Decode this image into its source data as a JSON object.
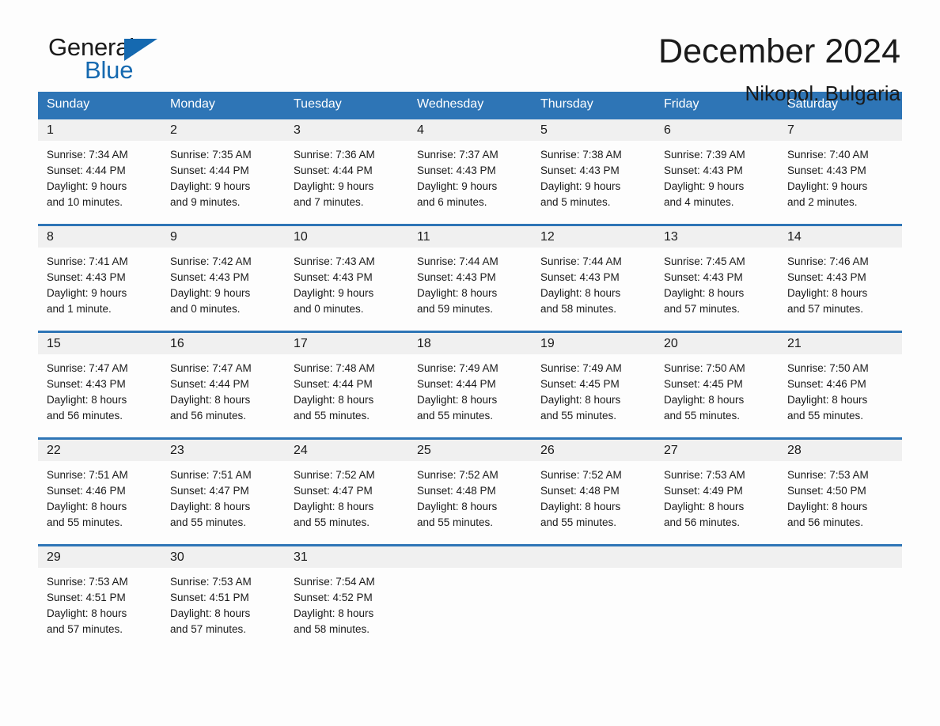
{
  "logo": {
    "word_one": "General",
    "word_two": "Blue",
    "accent_color": "#1569b0",
    "triangle_icon": "triangle-icon"
  },
  "header": {
    "title": "December 2024",
    "location": "Nikopol, Bulgaria"
  },
  "theme": {
    "header_blue": "#2e75b6",
    "row_border_blue": "#2e75b6",
    "date_band_gray": "#f0f0f0",
    "text_color": "#1a1a1a",
    "page_background": "#fdfdfd"
  },
  "weekdays": [
    "Sunday",
    "Monday",
    "Tuesday",
    "Wednesday",
    "Thursday",
    "Friday",
    "Saturday"
  ],
  "weeks": [
    [
      {
        "day": "1",
        "sunrise": "Sunrise: 7:34 AM",
        "sunset": "Sunset: 4:44 PM",
        "daylight_1": "Daylight: 9 hours",
        "daylight_2": "and 10 minutes."
      },
      {
        "day": "2",
        "sunrise": "Sunrise: 7:35 AM",
        "sunset": "Sunset: 4:44 PM",
        "daylight_1": "Daylight: 9 hours",
        "daylight_2": "and 9 minutes."
      },
      {
        "day": "3",
        "sunrise": "Sunrise: 7:36 AM",
        "sunset": "Sunset: 4:44 PM",
        "daylight_1": "Daylight: 9 hours",
        "daylight_2": "and 7 minutes."
      },
      {
        "day": "4",
        "sunrise": "Sunrise: 7:37 AM",
        "sunset": "Sunset: 4:43 PM",
        "daylight_1": "Daylight: 9 hours",
        "daylight_2": "and 6 minutes."
      },
      {
        "day": "5",
        "sunrise": "Sunrise: 7:38 AM",
        "sunset": "Sunset: 4:43 PM",
        "daylight_1": "Daylight: 9 hours",
        "daylight_2": "and 5 minutes."
      },
      {
        "day": "6",
        "sunrise": "Sunrise: 7:39 AM",
        "sunset": "Sunset: 4:43 PM",
        "daylight_1": "Daylight: 9 hours",
        "daylight_2": "and 4 minutes."
      },
      {
        "day": "7",
        "sunrise": "Sunrise: 7:40 AM",
        "sunset": "Sunset: 4:43 PM",
        "daylight_1": "Daylight: 9 hours",
        "daylight_2": "and 2 minutes."
      }
    ],
    [
      {
        "day": "8",
        "sunrise": "Sunrise: 7:41 AM",
        "sunset": "Sunset: 4:43 PM",
        "daylight_1": "Daylight: 9 hours",
        "daylight_2": "and 1 minute."
      },
      {
        "day": "9",
        "sunrise": "Sunrise: 7:42 AM",
        "sunset": "Sunset: 4:43 PM",
        "daylight_1": "Daylight: 9 hours",
        "daylight_2": "and 0 minutes."
      },
      {
        "day": "10",
        "sunrise": "Sunrise: 7:43 AM",
        "sunset": "Sunset: 4:43 PM",
        "daylight_1": "Daylight: 9 hours",
        "daylight_2": "and 0 minutes."
      },
      {
        "day": "11",
        "sunrise": "Sunrise: 7:44 AM",
        "sunset": "Sunset: 4:43 PM",
        "daylight_1": "Daylight: 8 hours",
        "daylight_2": "and 59 minutes."
      },
      {
        "day": "12",
        "sunrise": "Sunrise: 7:44 AM",
        "sunset": "Sunset: 4:43 PM",
        "daylight_1": "Daylight: 8 hours",
        "daylight_2": "and 58 minutes."
      },
      {
        "day": "13",
        "sunrise": "Sunrise: 7:45 AM",
        "sunset": "Sunset: 4:43 PM",
        "daylight_1": "Daylight: 8 hours",
        "daylight_2": "and 57 minutes."
      },
      {
        "day": "14",
        "sunrise": "Sunrise: 7:46 AM",
        "sunset": "Sunset: 4:43 PM",
        "daylight_1": "Daylight: 8 hours",
        "daylight_2": "and 57 minutes."
      }
    ],
    [
      {
        "day": "15",
        "sunrise": "Sunrise: 7:47 AM",
        "sunset": "Sunset: 4:43 PM",
        "daylight_1": "Daylight: 8 hours",
        "daylight_2": "and 56 minutes."
      },
      {
        "day": "16",
        "sunrise": "Sunrise: 7:47 AM",
        "sunset": "Sunset: 4:44 PM",
        "daylight_1": "Daylight: 8 hours",
        "daylight_2": "and 56 minutes."
      },
      {
        "day": "17",
        "sunrise": "Sunrise: 7:48 AM",
        "sunset": "Sunset: 4:44 PM",
        "daylight_1": "Daylight: 8 hours",
        "daylight_2": "and 55 minutes."
      },
      {
        "day": "18",
        "sunrise": "Sunrise: 7:49 AM",
        "sunset": "Sunset: 4:44 PM",
        "daylight_1": "Daylight: 8 hours",
        "daylight_2": "and 55 minutes."
      },
      {
        "day": "19",
        "sunrise": "Sunrise: 7:49 AM",
        "sunset": "Sunset: 4:45 PM",
        "daylight_1": "Daylight: 8 hours",
        "daylight_2": "and 55 minutes."
      },
      {
        "day": "20",
        "sunrise": "Sunrise: 7:50 AM",
        "sunset": "Sunset: 4:45 PM",
        "daylight_1": "Daylight: 8 hours",
        "daylight_2": "and 55 minutes."
      },
      {
        "day": "21",
        "sunrise": "Sunrise: 7:50 AM",
        "sunset": "Sunset: 4:46 PM",
        "daylight_1": "Daylight: 8 hours",
        "daylight_2": "and 55 minutes."
      }
    ],
    [
      {
        "day": "22",
        "sunrise": "Sunrise: 7:51 AM",
        "sunset": "Sunset: 4:46 PM",
        "daylight_1": "Daylight: 8 hours",
        "daylight_2": "and 55 minutes."
      },
      {
        "day": "23",
        "sunrise": "Sunrise: 7:51 AM",
        "sunset": "Sunset: 4:47 PM",
        "daylight_1": "Daylight: 8 hours",
        "daylight_2": "and 55 minutes."
      },
      {
        "day": "24",
        "sunrise": "Sunrise: 7:52 AM",
        "sunset": "Sunset: 4:47 PM",
        "daylight_1": "Daylight: 8 hours",
        "daylight_2": "and 55 minutes."
      },
      {
        "day": "25",
        "sunrise": "Sunrise: 7:52 AM",
        "sunset": "Sunset: 4:48 PM",
        "daylight_1": "Daylight: 8 hours",
        "daylight_2": "and 55 minutes."
      },
      {
        "day": "26",
        "sunrise": "Sunrise: 7:52 AM",
        "sunset": "Sunset: 4:48 PM",
        "daylight_1": "Daylight: 8 hours",
        "daylight_2": "and 55 minutes."
      },
      {
        "day": "27",
        "sunrise": "Sunrise: 7:53 AM",
        "sunset": "Sunset: 4:49 PM",
        "daylight_1": "Daylight: 8 hours",
        "daylight_2": "and 56 minutes."
      },
      {
        "day": "28",
        "sunrise": "Sunrise: 7:53 AM",
        "sunset": "Sunset: 4:50 PM",
        "daylight_1": "Daylight: 8 hours",
        "daylight_2": "and 56 minutes."
      }
    ],
    [
      {
        "day": "29",
        "sunrise": "Sunrise: 7:53 AM",
        "sunset": "Sunset: 4:51 PM",
        "daylight_1": "Daylight: 8 hours",
        "daylight_2": "and 57 minutes."
      },
      {
        "day": "30",
        "sunrise": "Sunrise: 7:53 AM",
        "sunset": "Sunset: 4:51 PM",
        "daylight_1": "Daylight: 8 hours",
        "daylight_2": "and 57 minutes."
      },
      {
        "day": "31",
        "sunrise": "Sunrise: 7:54 AM",
        "sunset": "Sunset: 4:52 PM",
        "daylight_1": "Daylight: 8 hours",
        "daylight_2": "and 58 minutes."
      },
      {
        "day": "",
        "sunrise": "",
        "sunset": "",
        "daylight_1": "",
        "daylight_2": ""
      },
      {
        "day": "",
        "sunrise": "",
        "sunset": "",
        "daylight_1": "",
        "daylight_2": ""
      },
      {
        "day": "",
        "sunrise": "",
        "sunset": "",
        "daylight_1": "",
        "daylight_2": ""
      },
      {
        "day": "",
        "sunrise": "",
        "sunset": "",
        "daylight_1": "",
        "daylight_2": ""
      }
    ]
  ]
}
